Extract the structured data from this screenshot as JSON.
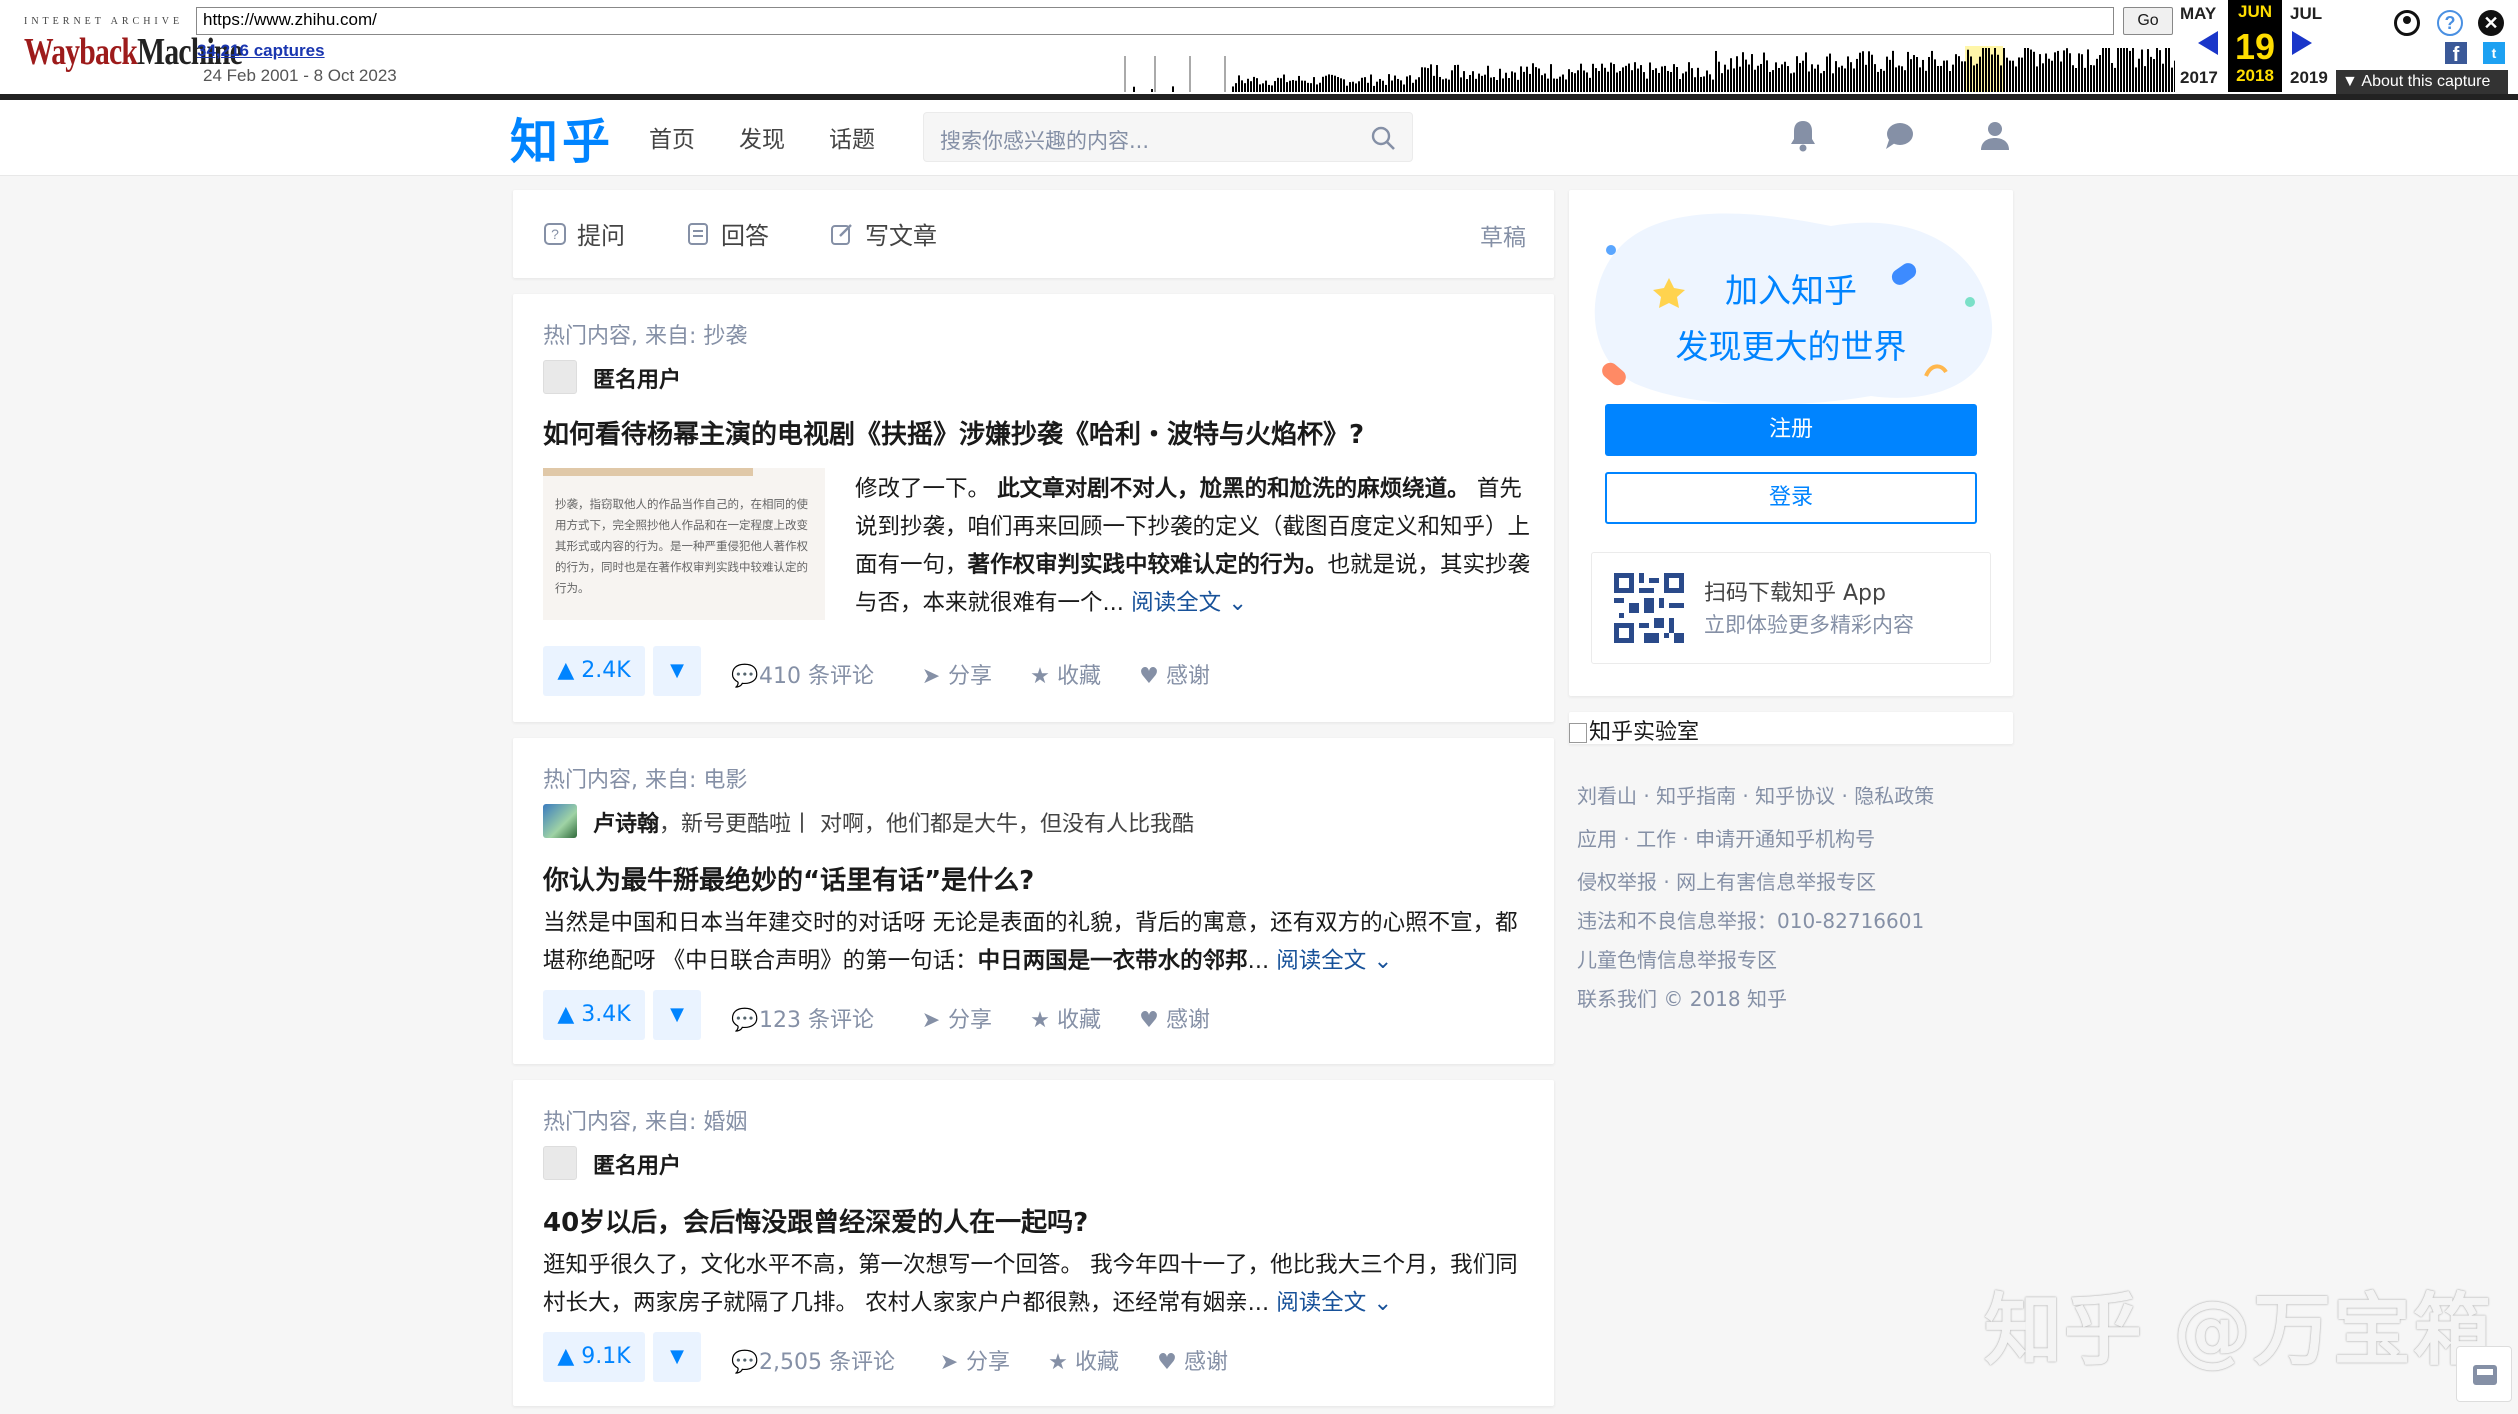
{
  "wayback": {
    "logo_top": "INTERNET ARCHIVE",
    "logo_a": "Wayback",
    "logo_b": "Machine",
    "url": "https://www.zhihu.com/",
    "go": "Go",
    "captures": "34,216 captures",
    "range": "24 Feb 2001 - 8 Oct 2023",
    "prev_month": "MAY",
    "cur_month": "JUN",
    "next_month": "JUL",
    "cur_day": "19",
    "prev_year": "2017",
    "cur_year": "2018",
    "next_year": "2019",
    "about": "▼ About this capture",
    "fb": "f",
    "tw": "t",
    "help": "?",
    "close": "✕"
  },
  "header": {
    "logo": "知乎",
    "nav": [
      "首页",
      "发现",
      "话题"
    ],
    "search_placeholder": "搜索你感兴趣的内容..."
  },
  "writer": {
    "ask": "提问",
    "answer": "回答",
    "article": "写文章",
    "draft": "草稿"
  },
  "feed": [
    {
      "source": "热门内容, 来自: 抄袭",
      "author": "匿名用户",
      "title": "如何看待杨幂主演的电视剧《扶摇》涉嫌抄袭《哈利・波特与火焰杯》?",
      "thumb_text": "抄袭，指窃取他人的作品当作自己的，在相同的使用方式下，完全照抄他人作品和在一定程度上改变其形式或内容的行为。是一种严重侵犯他人著作权的行为，同时也是在著作权审判实践中较难认定的行为。",
      "excerpt_1": "修改了一下。",
      "excerpt_b1": "此文章对剧不对人，尬黑的和尬洗的麻烦绕道。",
      "excerpt_2": "首先说到抄袭，咱们再来回顾一下抄袭的定义（截图百度定义和知乎）上面有一句，",
      "excerpt_b2": "著作权审判实践中较难认定的行为。",
      "excerpt_3": "也就是说，其实抄袭与否，本来就很难有一个...",
      "read_more": "阅读全文 ⌄",
      "votes": "▲ 2.4K",
      "comments": "410 条评论",
      "share": "分享",
      "fav": "收藏",
      "thanks": "感谢"
    },
    {
      "source": "热门内容, 来自: 电影",
      "author": "卢诗翰",
      "bio": "，新号更酷啦丨 对啊，他们都是大牛，但没有人比我酷",
      "title": "你认为最牛掰最绝妙的“话里有话”是什么?",
      "excerpt_1": "当然是中国和日本当年建交时的对话呀 无论是表面的礼貌，背后的寓意，还有双方的心照不宣，都堪称绝配呀 《中日联合声明》的第一句话：",
      "excerpt_b1": "中日两国是一衣带水的邻邦",
      "excerpt_2": "...",
      "read_more": "阅读全文 ⌄",
      "votes": "▲ 3.4K",
      "comments": "123 条评论",
      "share": "分享",
      "fav": "收藏",
      "thanks": "感谢"
    },
    {
      "source": "热门内容, 来自: 婚姻",
      "author": "匿名用户",
      "title": "40岁以后，会后悔没跟曾经深爱的人在一起吗?",
      "excerpt_1": "逛知乎很久了，文化水平不高，第一次想写一个回答。 我今年四十一了，他比我大三个月，我们同村长大，两家房子就隔了几排。 农村人家家户户都很熟，还经常有姻亲...",
      "read_more": "阅读全文 ⌄",
      "votes": "▲ 9.1K",
      "comments": "2,505 条评论",
      "share": "分享",
      "fav": "收藏",
      "thanks": "感谢"
    }
  ],
  "sidebar": {
    "join_1": "加入知乎",
    "join_2": "发现更大的世界",
    "register": "注册",
    "login": "登录",
    "app_1": "扫码下载知乎 App",
    "app_2": "立即体验更多精彩内容",
    "lab": "知乎实验室",
    "footer": [
      "刘看山 · 知乎指南 · 知乎协议 · 隐私政策",
      "应用 · 工作 · 申请开通知乎机构号",
      "侵权举报 · 网上有害信息举报专区",
      "违法和不良信息举报：010-82716601",
      "儿童色情信息举报专区",
      "联系我们 © 2018 知乎"
    ]
  },
  "watermark": "知乎 @万宝箱",
  "colors": {
    "brand": "#0084ff",
    "meta": "#8590a6",
    "link": "#175199",
    "wayback_red": "#9d1b1b"
  }
}
